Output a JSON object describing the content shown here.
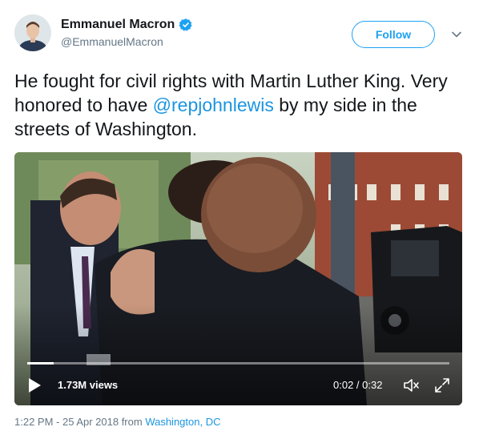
{
  "author": {
    "name": "Emmanuel Macron",
    "handle": "@EmmanuelMacron",
    "verified": true
  },
  "actions": {
    "follow_label": "Follow"
  },
  "tweet": {
    "text_before": "He fought for civil rights with Martin Luther King. Very honored to have ",
    "mention": "@repjohnlewis",
    "text_after": " by my side in the streets of Washington."
  },
  "video": {
    "views": "1.73M views",
    "time": "0:02 / 0:32",
    "progress_fraction": 0.0625
  },
  "meta": {
    "timestamp": "1:22 PM - 25 Apr 2018 from ",
    "location": "Washington, DC"
  },
  "colors": {
    "accent": "#1da1f2",
    "link": "#1b95e0",
    "muted": "#657786"
  }
}
